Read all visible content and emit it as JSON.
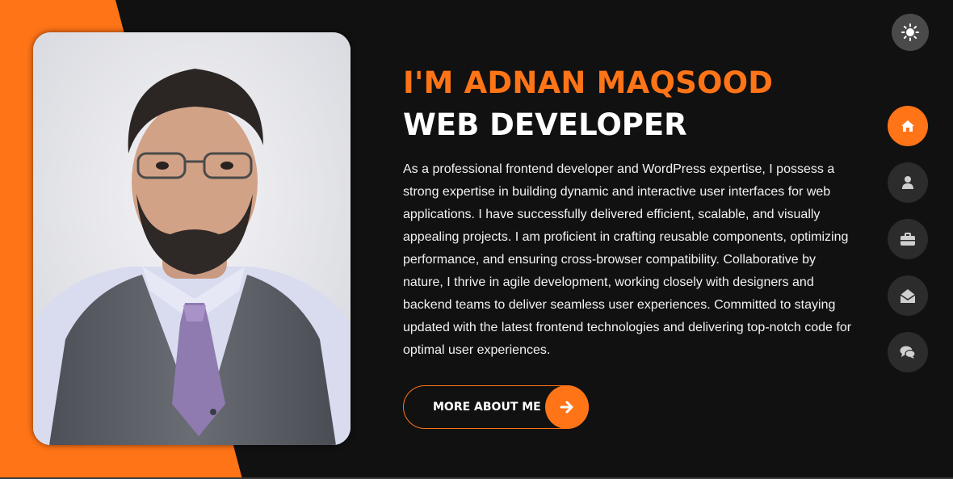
{
  "hero": {
    "name_heading": "I'M ADNAN MAQSOOD",
    "role_heading": "WEB DEVELOPER",
    "bio": "As a professional frontend developer and WordPress expertise, I possess a strong expertise in building dynamic and interactive user interfaces for web applications. I have successfully delivered efficient, scalable, and visually appealing projects. I am proficient in crafting reusable components, optimizing performance, and ensuring cross-browser compatibility. Collaborative by nature, I thrive in agile development, working closely with designers and backend teams to deliver seamless user experiences. Committed to staying updated with the latest frontend technologies and delivering top-notch code for optimal user experiences.",
    "more_button_label": "MORE ABOUT ME",
    "more_button_icon": "arrow-right-icon"
  },
  "theme_toggle": {
    "icon": "sun-icon"
  },
  "side_nav": {
    "items": [
      {
        "id": "home",
        "icon": "home-icon",
        "active": true
      },
      {
        "id": "about",
        "icon": "user-icon",
        "active": false
      },
      {
        "id": "portfolio",
        "icon": "briefcase-icon",
        "active": false
      },
      {
        "id": "contact",
        "icon": "envelope-open-icon",
        "active": false
      },
      {
        "id": "blog",
        "icon": "comments-icon",
        "active": false
      }
    ]
  },
  "colors": {
    "accent": "#ff7417",
    "background": "#111111",
    "nav_inactive": "#2c2c2c",
    "toggle_bg": "#4a4a4a"
  }
}
